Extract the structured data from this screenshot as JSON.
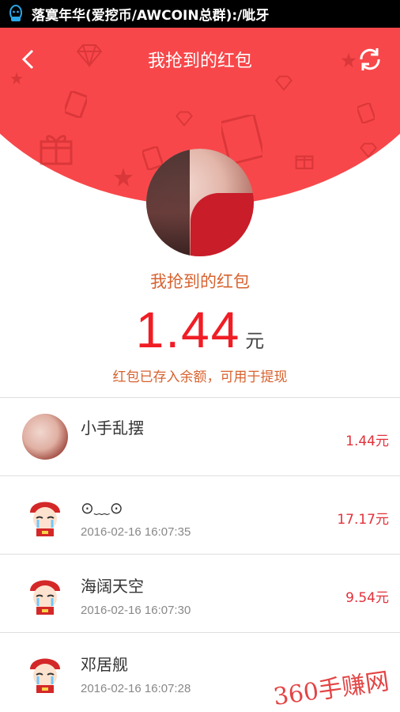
{
  "statusbar": {
    "notification": "落寞年华(爱挖币/AWCOIN总群):/呲牙",
    "app_icon": "qq-icon"
  },
  "header": {
    "title": "我抢到的红包",
    "back_icon": "back-arrow-icon",
    "refresh_icon": "refresh-icon",
    "color": "#f8474a"
  },
  "summary": {
    "title": "我抢到的红包",
    "amount": "1.44",
    "unit": "元",
    "note": "红包已存入余额，可用于提现"
  },
  "records": [
    {
      "name": "小手乱摆",
      "time": "",
      "amount": "1.44元",
      "avatar": "photo"
    },
    {
      "name": "⊙﹏⊙",
      "time": "2016-02-16 16:07:35",
      "amount": "17.17元",
      "avatar": "cartoon"
    },
    {
      "name": "海阔天空",
      "time": "2016-02-16 16:07:30",
      "amount": "9.54元",
      "avatar": "cartoon"
    },
    {
      "name": "邓居舰",
      "time": "2016-02-16 16:07:28",
      "amount": "",
      "avatar": "cartoon"
    }
  ],
  "watermark": "360手赚网",
  "colors": {
    "accent": "#f01d25",
    "orange_text": "#d7622f"
  }
}
